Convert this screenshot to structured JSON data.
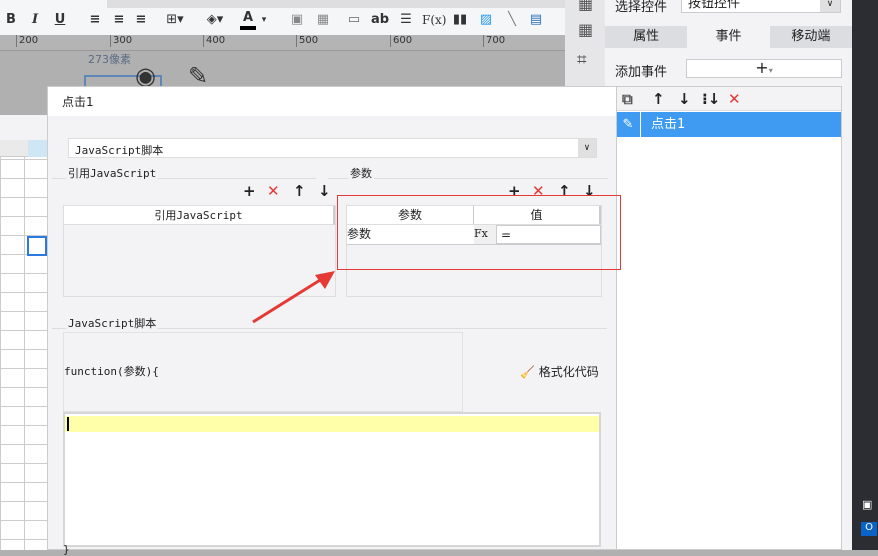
{
  "toolbar": {
    "bold": "B",
    "italic": "I",
    "underline": "U",
    "text_ab": "ab",
    "fx": "F(x)",
    "font_color": "A"
  },
  "ruler": {
    "ticks": [
      "200",
      "300",
      "400",
      "500",
      "600",
      "700"
    ]
  },
  "canvas": {
    "size_label": "273像素"
  },
  "right_panel": {
    "select_label": "选择控件",
    "select_value": "按钮控件",
    "tabs": [
      "属性",
      "事件",
      "移动端"
    ],
    "active_tab": "事件",
    "add_event_label": "添加事件",
    "events": [
      "点击1"
    ]
  },
  "dialog": {
    "title": "点击1",
    "type_select": "JavaScript脚本",
    "ref_js_section": "引用JavaScript",
    "ref_js_column": "引用JavaScript",
    "params_section": "参数",
    "params_columns": [
      "参数",
      "值"
    ],
    "params_rows": [
      {
        "name": "参数",
        "value": "="
      }
    ],
    "script_section": "JavaScript脚本",
    "function_signature": "function(参数){",
    "format_button": "格式化代码",
    "closing_brace": "}"
  },
  "colors": {
    "accent": "#3f9bf2",
    "highlight": "#ffffaa",
    "annotation": "#e53935"
  }
}
